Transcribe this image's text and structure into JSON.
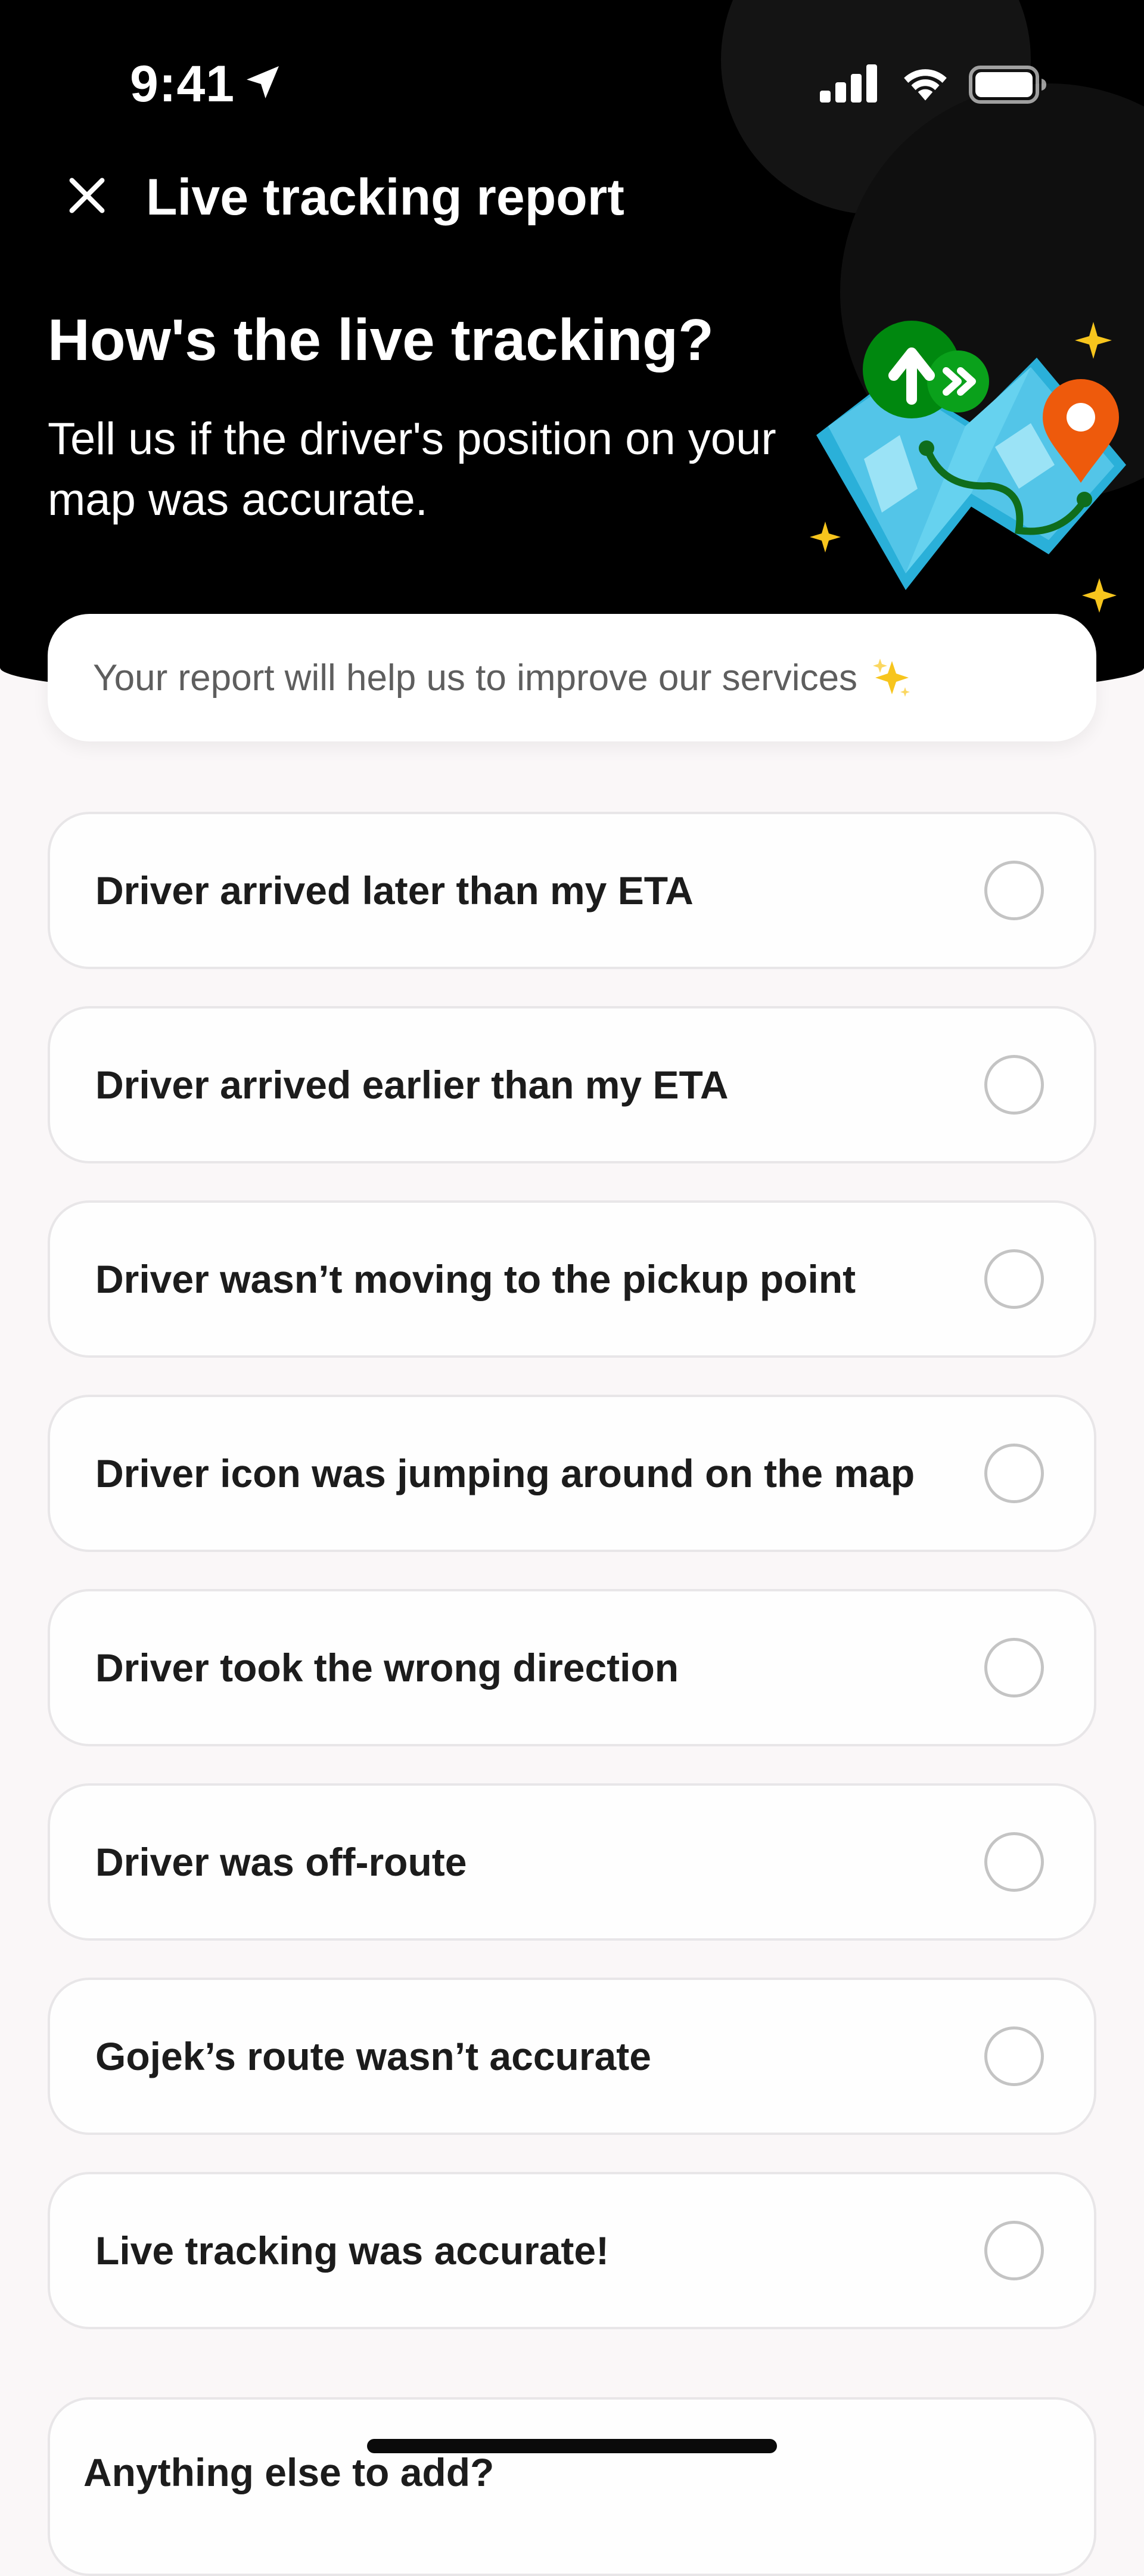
{
  "status_bar": {
    "time": "9:41",
    "icons": [
      "location-arrow-icon",
      "cellular-signal-icon",
      "wifi-icon",
      "battery-icon"
    ]
  },
  "nav": {
    "close_icon": "close-icon",
    "title": "Live tracking report"
  },
  "hero": {
    "heading": "How's the live tracking?",
    "subheading": "Tell us if the driver's position on your map was accurate.",
    "illustration": "map-tracking-illustration"
  },
  "info_banner": {
    "text": "Your report will help us to improve our services",
    "icon": "sparkles-icon"
  },
  "options": [
    {
      "label": "Driver arrived later than my ETA",
      "selected": false
    },
    {
      "label": "Driver arrived earlier than my ETA",
      "selected": false
    },
    {
      "label": "Driver wasn’t moving to the pickup point",
      "selected": false
    },
    {
      "label": "Driver icon was jumping around on the map",
      "selected": false
    },
    {
      "label": "Driver took the wrong direction",
      "selected": false
    },
    {
      "label": "Driver was off-route",
      "selected": false
    },
    {
      "label": "Gojek’s route wasn’t accurate",
      "selected": false
    },
    {
      "label": "Live tracking was accurate!",
      "selected": false
    }
  ],
  "extra": {
    "title": "Anything else to add?"
  },
  "colors": {
    "header_bg": "#000000",
    "page_bg": "#faf7f8",
    "brand_green": "#00880f",
    "accent_orange": "#ee5a0c",
    "map_blue": "#5fcdea",
    "sparkle_yellow": "#f7c51d"
  }
}
